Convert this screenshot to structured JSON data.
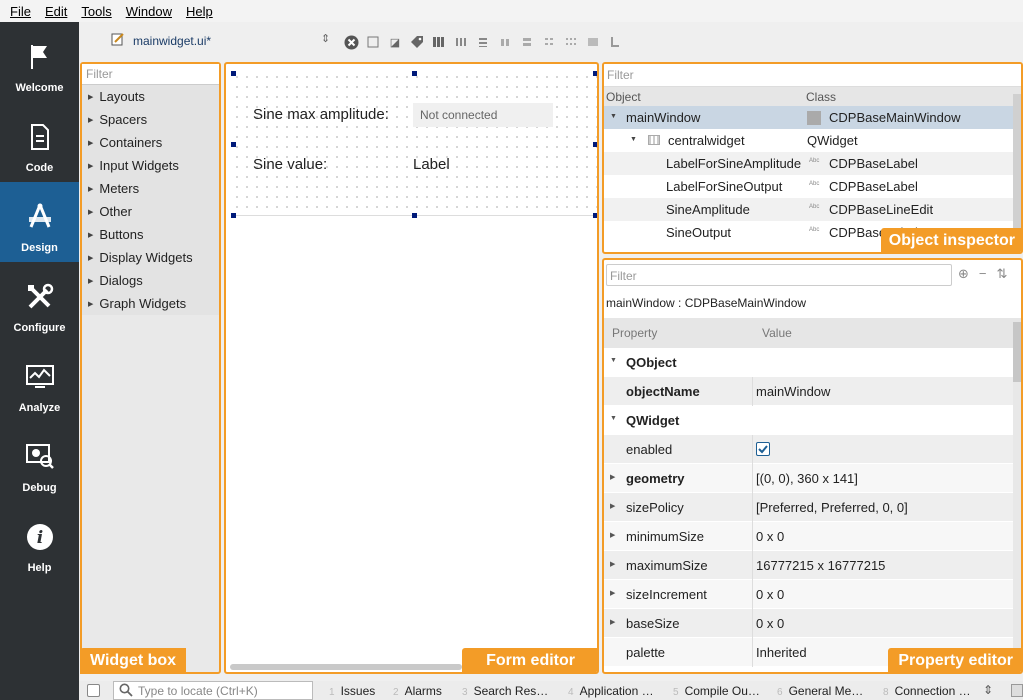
{
  "menubar": {
    "items": [
      "File",
      "Edit",
      "Tools",
      "Window",
      "Help"
    ]
  },
  "modebar": {
    "modes": [
      {
        "label": "Welcome",
        "icon": "flag-icon"
      },
      {
        "label": "Code",
        "icon": "document-icon"
      },
      {
        "label": "Design",
        "icon": "design-icon",
        "active": true
      },
      {
        "label": "Configure",
        "icon": "tools-icon"
      },
      {
        "label": "Analyze",
        "icon": "analyze-chart-icon"
      },
      {
        "label": "Debug",
        "icon": "debug-icon"
      },
      {
        "label": "Help",
        "icon": "info-icon"
      }
    ]
  },
  "toolbar": {
    "file_name": "mainwidget.ui*"
  },
  "widget_box": {
    "filter_placeholder": "Filter",
    "categories": [
      "Layouts",
      "Spacers",
      "Containers",
      "Input Widgets",
      "Meters",
      "Other",
      "Buttons",
      "Display Widgets",
      "Dialogs",
      "Graph Widgets"
    ],
    "callout": "Widget box"
  },
  "form_editor": {
    "sine_max_label": "Sine max amplitude:",
    "sine_max_value": "Not connected",
    "sine_value_label": "Sine value:",
    "sine_value_value": "Label",
    "callout": "Form editor"
  },
  "object_inspector": {
    "filter_placeholder": "Filter",
    "col_object": "Object",
    "col_class": "Class",
    "rows": [
      {
        "object": "mainWindow",
        "class": "CDPBaseMainWindow"
      },
      {
        "object": "centralwidget",
        "class": "QWidget"
      },
      {
        "object": "LabelForSineAmplitude",
        "class": "CDPBaseLabel"
      },
      {
        "object": "LabelForSineOutput",
        "class": "CDPBaseLabel"
      },
      {
        "object": "SineAmplitude",
        "class": "CDPBaseLineEdit"
      },
      {
        "object": "SineOutput",
        "class": "CDPBaseLabel"
      }
    ],
    "callout": "Object inspector"
  },
  "property_editor": {
    "filter_placeholder": "Filter",
    "object_line": "mainWindow : CDPBaseMainWindow",
    "col_property": "Property",
    "col_value": "Value",
    "groups": {
      "qobject": "QObject",
      "qwidget": "QWidget"
    },
    "props": {
      "objectName": {
        "name": "objectName",
        "value": "mainWindow"
      },
      "enabled": {
        "name": "enabled",
        "checked": true
      },
      "geometry": {
        "name": "geometry",
        "value": "[(0, 0), 360 x 141]"
      },
      "sizePolicy": {
        "name": "sizePolicy",
        "value": "[Preferred, Preferred, 0, 0]"
      },
      "minimumSize": {
        "name": "minimumSize",
        "value": "0 x 0"
      },
      "maximumSize": {
        "name": "maximumSize",
        "value": "16777215 x 16777215"
      },
      "sizeIncrement": {
        "name": "sizeIncrement",
        "value": "0 x 0"
      },
      "baseSize": {
        "name": "baseSize",
        "value": "0 x 0"
      },
      "palette": {
        "name": "palette",
        "value": "Inherited"
      }
    },
    "callout": "Property editor"
  },
  "statusbar": {
    "locate_placeholder": "Type to locate (Ctrl+K)",
    "tabs": [
      {
        "num": "1",
        "label": "Issues"
      },
      {
        "num": "2",
        "label": "Alarms"
      },
      {
        "num": "3",
        "label": "Search Res…"
      },
      {
        "num": "4",
        "label": "Application …"
      },
      {
        "num": "5",
        "label": "Compile Ou…"
      },
      {
        "num": "6",
        "label": "General Me…"
      },
      {
        "num": "8",
        "label": "Connection …"
      }
    ]
  },
  "colors": {
    "accent_orange": "#f39c27",
    "sidebar_bg": "#2d3134",
    "active_mode_bg": "#1d5f94",
    "selection_bg": "#c9d6e3"
  }
}
